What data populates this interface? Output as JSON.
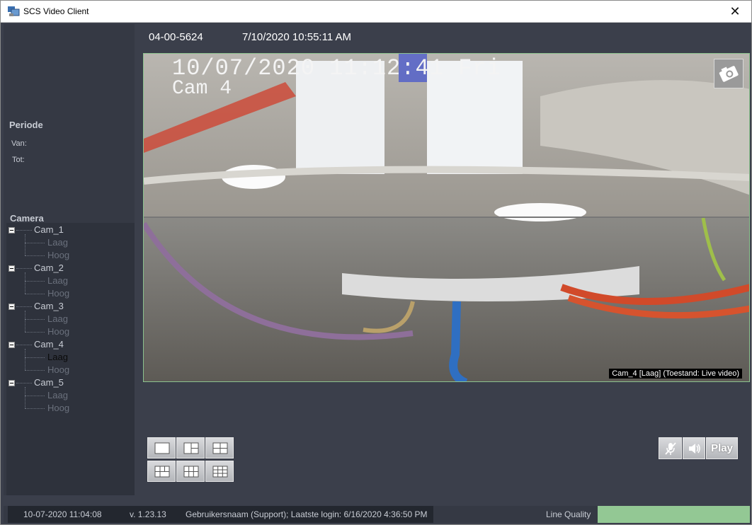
{
  "window": {
    "title": "SCS Video Client",
    "close_glyph": "✕"
  },
  "sidebar": {
    "periode_label": "Periode",
    "van_label": "Van:",
    "tot_label": "Tot:",
    "camera_label": "Camera",
    "cameras": [
      {
        "name": "Cam_1",
        "streams": [
          "Laag",
          "Hoog"
        ]
      },
      {
        "name": "Cam_2",
        "streams": [
          "Laag",
          "Hoog"
        ]
      },
      {
        "name": "Cam_3",
        "streams": [
          "Laag",
          "Hoog"
        ]
      },
      {
        "name": "Cam_4",
        "streams": [
          "Laag",
          "Hoog"
        ]
      },
      {
        "name": "Cam_5",
        "streams": [
          "Laag",
          "Hoog"
        ]
      }
    ],
    "selected": "Cam_4 / Laag"
  },
  "header": {
    "device_id": "04-00-5624",
    "datetime": "7/10/2020 10:55:11 AM"
  },
  "video": {
    "osd_datetime": "10/07/2020 11:12:41 Fri",
    "osd_camera": "Cam 4",
    "status": "Cam_4 [Laag] (Toestand: Live video)",
    "snapshot_icon": "camera-snapshot-icon",
    "border_color": "#8cc38e"
  },
  "layout_buttons": [
    "layout-1x1-icon",
    "layout-1plus2-icon",
    "layout-2x2-icon",
    "layout-1plus3-icon",
    "layout-3x2-icon",
    "layout-3x3-icon"
  ],
  "media": {
    "mute_icon": "mic-muted-icon",
    "audio_icon": "speaker-icon",
    "play_label": "Play"
  },
  "statusbar": {
    "date": "10-07-2020 11:04:08",
    "version": "v. 1.23.13",
    "user": "Gebruikersnaam (Support); Laatste login: 6/16/2020 4:36:50 PM",
    "line_quality_label": "Line Quality",
    "line_quality_color": "#93c894"
  }
}
